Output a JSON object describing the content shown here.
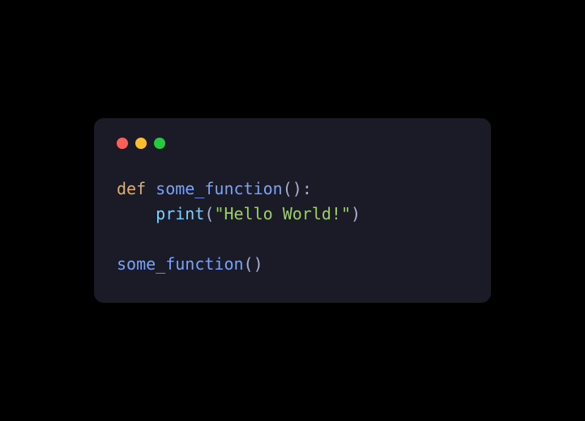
{
  "window": {
    "traffic_lights": {
      "close": "close",
      "minimize": "minimize",
      "maximize": "maximize"
    }
  },
  "code": {
    "line1": {
      "keyword": "def",
      "space": " ",
      "funcname": "some_function",
      "parens": "()",
      "colon": ":"
    },
    "line2": {
      "indent": "    ",
      "builtin": "print",
      "open": "(",
      "string": "\"Hello World!\"",
      "close": ")"
    },
    "line4": {
      "funcname": "some_function",
      "parens": "()"
    }
  }
}
